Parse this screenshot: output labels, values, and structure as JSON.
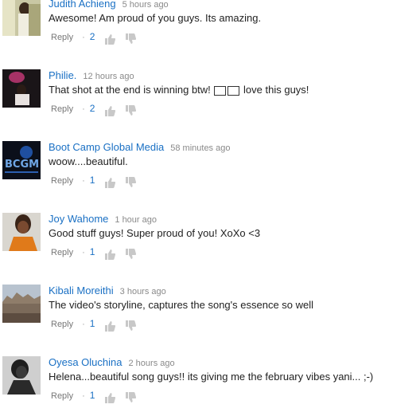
{
  "comments": [
    {
      "author": "Judith Achieng",
      "time": "5 hours ago",
      "text": "Awesome! Am proud of you guys. Its amazing.",
      "reply": "Reply",
      "likes": "2"
    },
    {
      "author": "Philie.",
      "time": "12 hours ago",
      "text_before": "That shot at the end is winning btw!",
      "text_after": "love this guys!",
      "reply": "Reply",
      "likes": "2"
    },
    {
      "author": "Boot Camp Global Media",
      "time": "58 minutes ago",
      "text": "woow....beautiful.",
      "reply": "Reply",
      "likes": "1",
      "avatar_text": "BCGM"
    },
    {
      "author": "Joy Wahome",
      "time": "1 hour ago",
      "text": "Good stuff guys! Super proud of you!  XoXo <3",
      "reply": "Reply",
      "likes": "1"
    },
    {
      "author": "Kibali Moreithi",
      "time": "3 hours ago",
      "text": "The video's storyline, captures the song's essence so well",
      "reply": "Reply",
      "likes": "1"
    },
    {
      "author": "Oyesa Oluchina",
      "time": "2 hours ago",
      "text": "Helena...beautiful song guys!! its giving me the february vibes yani... ;-)",
      "reply": "Reply",
      "likes": "1"
    }
  ],
  "colors": {
    "author": "#1a70c4",
    "text": "#222222",
    "meta": "#8a8a8a"
  }
}
